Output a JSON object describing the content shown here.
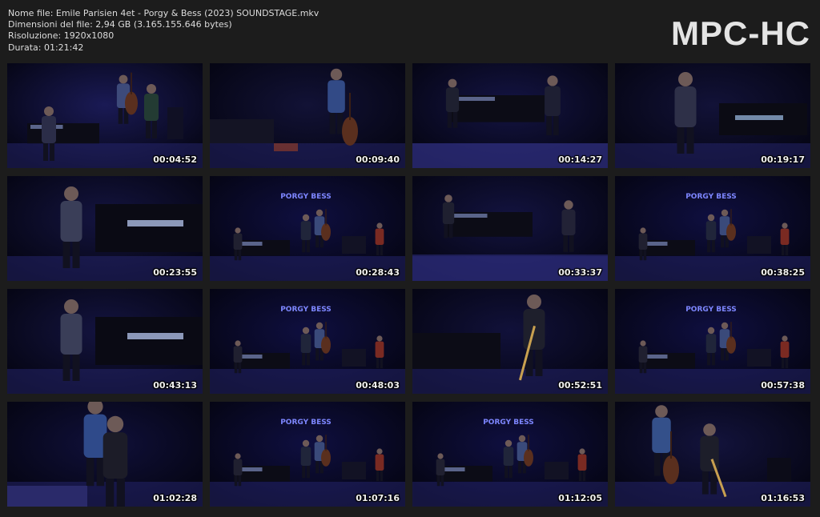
{
  "file_info": {
    "name": "Nome file: Emile Parisien 4et - Porgy & Bess (2023) SOUNDSTAGE.mkv",
    "size": "Dimensioni del file: 2,94 GB (3.165.155.646 bytes)",
    "resolution": "Risoluzione: 1920x1080",
    "duration": "Durata: 01:21:42"
  },
  "logo": "MPC-HC",
  "thumbnails": [
    {
      "time": "00:04:52",
      "scene": "band"
    },
    {
      "time": "00:09:40",
      "scene": "bass"
    },
    {
      "time": "00:14:27",
      "scene": "sax"
    },
    {
      "time": "00:19:17",
      "scene": "piano"
    },
    {
      "time": "00:23:55",
      "scene": "piano-close"
    },
    {
      "time": "00:28:43",
      "scene": "wide"
    },
    {
      "time": "00:33:37",
      "scene": "sax-wide"
    },
    {
      "time": "00:38:25",
      "scene": "wide"
    },
    {
      "time": "00:43:13",
      "scene": "piano-close"
    },
    {
      "time": "00:48:03",
      "scene": "wide"
    },
    {
      "time": "00:52:51",
      "scene": "soprano"
    },
    {
      "time": "00:57:38",
      "scene": "wide"
    },
    {
      "time": "01:02:28",
      "scene": "closeup"
    },
    {
      "time": "01:07:16",
      "scene": "wide"
    },
    {
      "time": "01:12:05",
      "scene": "wide"
    },
    {
      "time": "01:16:53",
      "scene": "duo"
    }
  ]
}
